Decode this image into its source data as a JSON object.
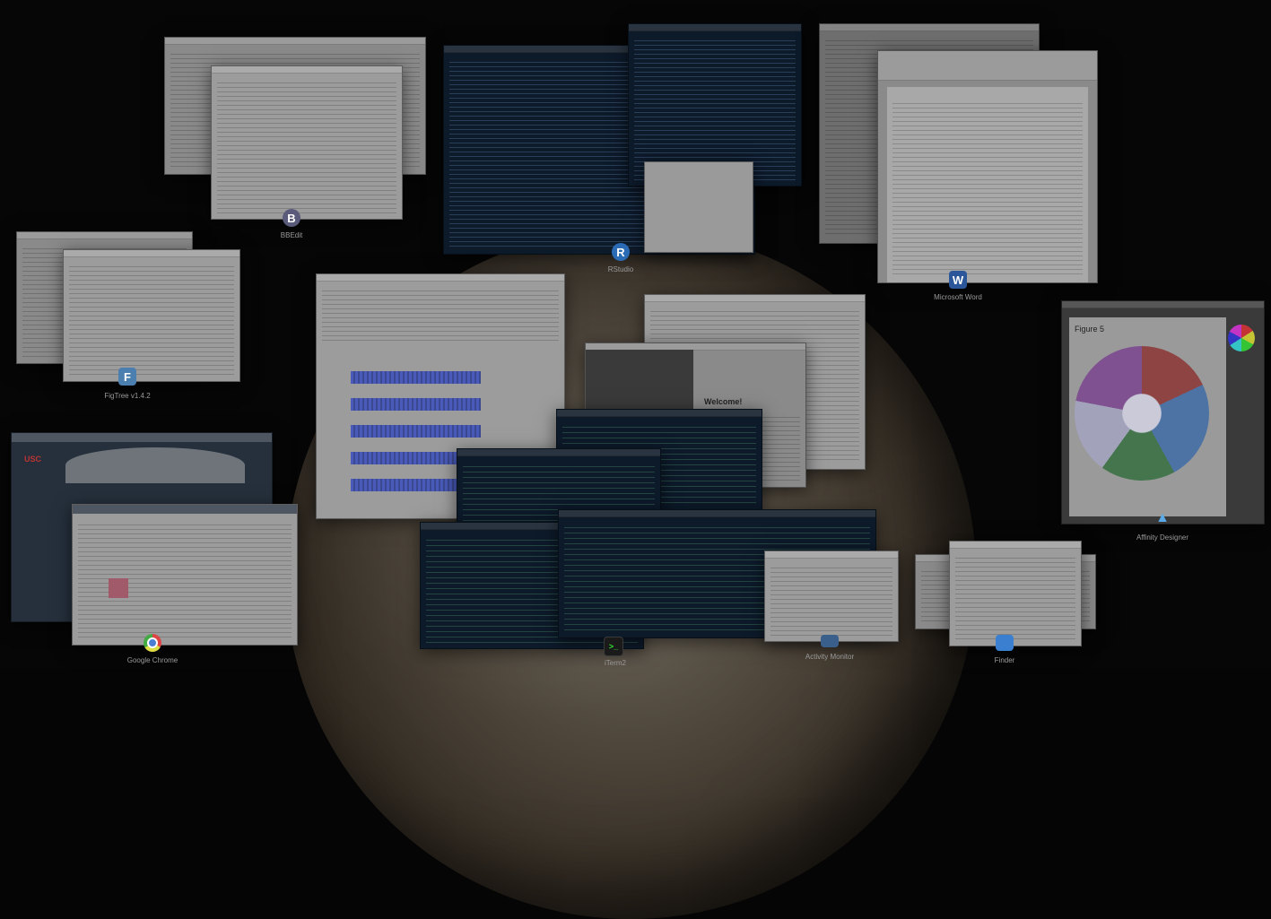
{
  "screen": {
    "mode": "Mission Control",
    "wallpaper": "planet"
  },
  "apps": [
    {
      "name": "BBEdit",
      "icon": "bbedit-icon"
    },
    {
      "name": "RStudio",
      "icon": "r-icon"
    },
    {
      "name": "Microsoft Word",
      "icon": "word-icon"
    },
    {
      "name": "FigTree v1.4.2",
      "icon": "figtree-icon"
    },
    {
      "name": "Affinity Designer",
      "icon": "affinity-designer-icon"
    },
    {
      "name": "Google Chrome",
      "icon": "chrome-icon"
    },
    {
      "name": "iTerm2",
      "icon": "terminal-icon"
    },
    {
      "name": "Activity Monitor",
      "icon": "activity-monitor-icon"
    },
    {
      "name": "Finder",
      "icon": "finder-icon"
    }
  ],
  "windows": {
    "chrome_site_label": "USC",
    "affinity_doc_title": "Figure 5",
    "welcome_heading": "Welcome!"
  },
  "colors": {
    "background": "#050505",
    "terminal_bg": "#0d1a2a",
    "r_blue": "#2b6bb5",
    "word_blue": "#2b579a"
  }
}
